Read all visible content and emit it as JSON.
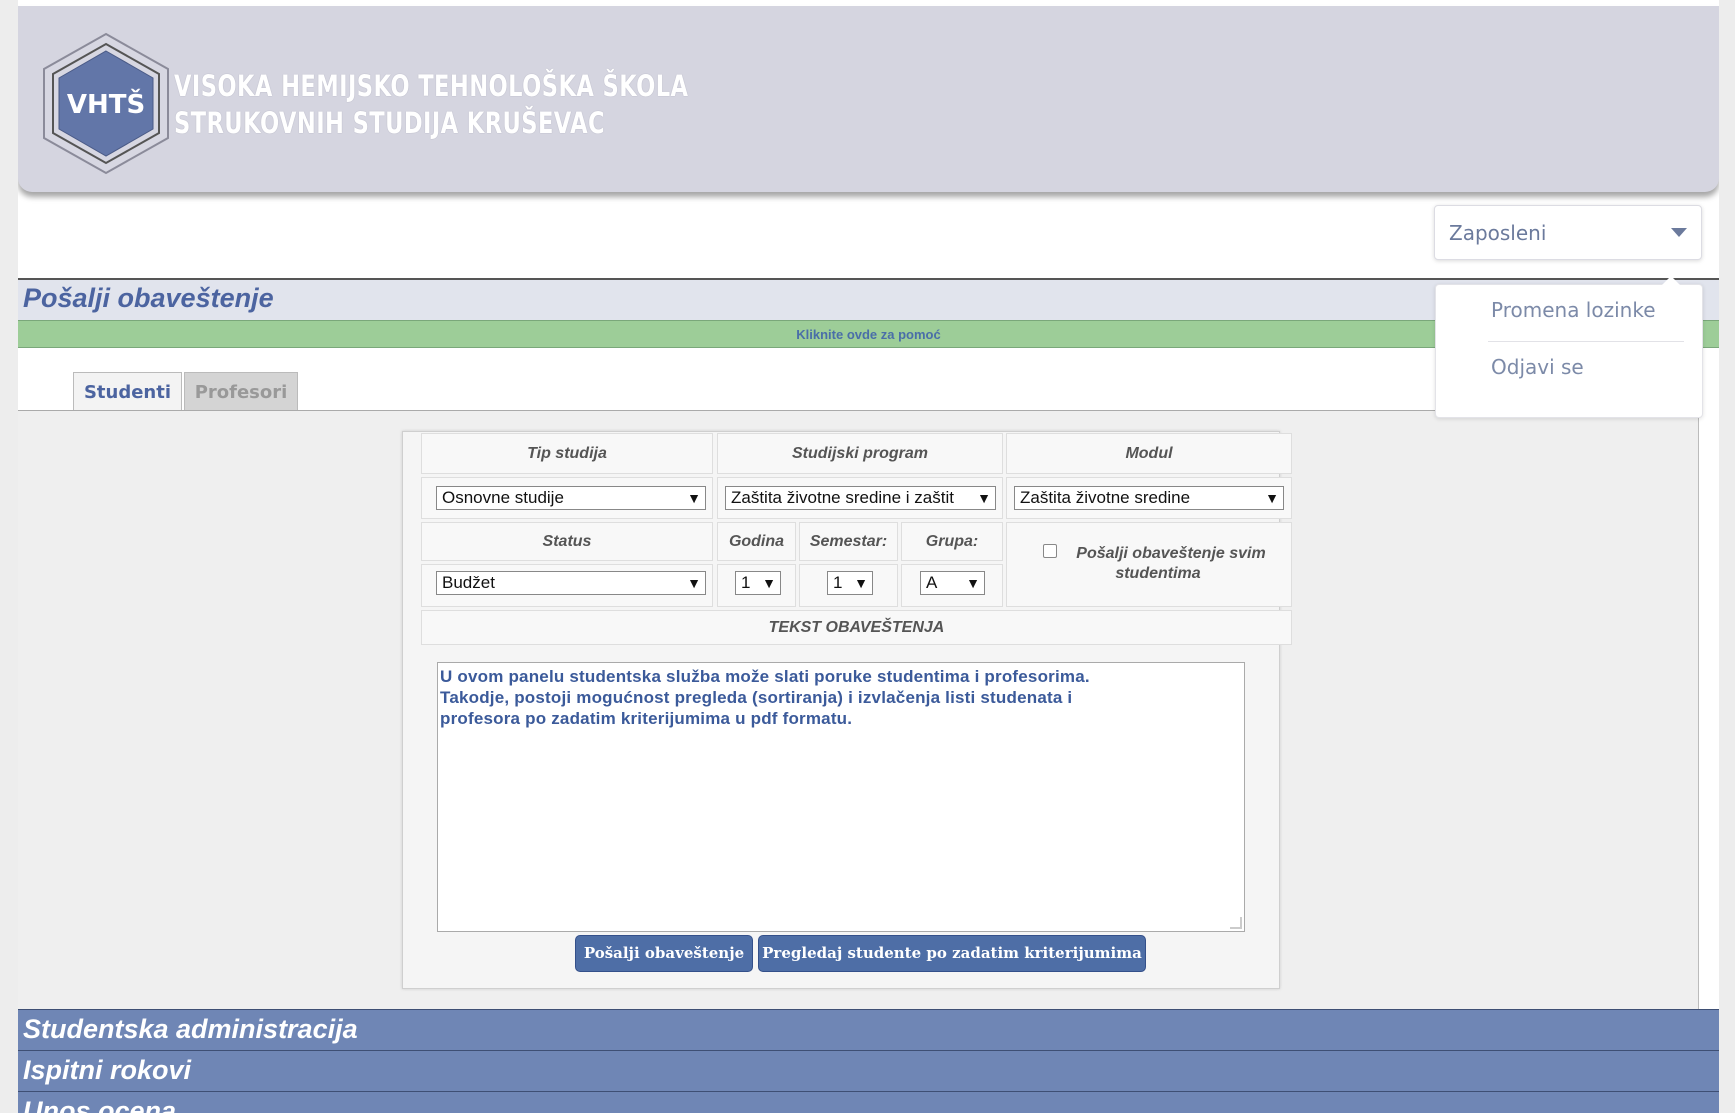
{
  "header": {
    "logo_abbr": "VHTŠ",
    "school_line1": "VISOKA HEMIJSKO TEHNOLOŠKA ŠKOLA",
    "school_line2": "STRUKOVNIH STUDIJA KRUŠEVAC"
  },
  "user_menu": {
    "label": "Zaposleni",
    "items": [
      "Promena lozinke",
      "Odjavi se"
    ]
  },
  "section": {
    "title": "Pošalji obaveštenje",
    "help_link": "Kliknite ovde za pomoć"
  },
  "tabs": [
    {
      "label": "Studenti",
      "active": true
    },
    {
      "label": "Profesori",
      "active": false
    }
  ],
  "form": {
    "headers": {
      "tip_studija": "Tip studija",
      "studijski_program": "Studijski program",
      "modul": "Modul",
      "status": "Status",
      "godina": "Godina",
      "semestar": "Semestar:",
      "grupa": "Grupa:",
      "tekst": "TEKST OBAVEŠTENJA"
    },
    "values": {
      "tip_studija": "Osnovne studije",
      "studijski_program": "Zaštita životne sredine i zaštit",
      "modul": "Zaštita životne sredine",
      "status": "Budžet",
      "godina": "1",
      "semestar": "1",
      "grupa": "A"
    },
    "send_all_label_line1": "Pošalji obaveštenje svim",
    "send_all_label_line2": "studentima",
    "message_line1": "U ovom panelu studentska služba može slati poruke studentima i profesorima.",
    "message_line2": "Takodje, postoji mogućnost pregleda (sortiranja) i izvlačenja listi studenata i",
    "message_line3": "profesora po zadatim kriterijumima u pdf formatu.",
    "send_button": "Pošalji obaveštenje",
    "review_button": "Pregledaj studente po zadatim kriterijumima"
  },
  "accordion": [
    "Studentska administracija",
    "Ispitni rokovi",
    "Unos ocena"
  ],
  "colors": {
    "header_bg": "#d5d5e0",
    "accent_blue": "#4c64a0",
    "accordion_bg": "#6f86b5",
    "help_bar": "#9dcd98",
    "button_bg": "#4e6ea6"
  },
  "icons": {
    "dropdown": "caret-down-icon",
    "select": "triangle-down-icon",
    "logo": "hexagon-logo"
  }
}
